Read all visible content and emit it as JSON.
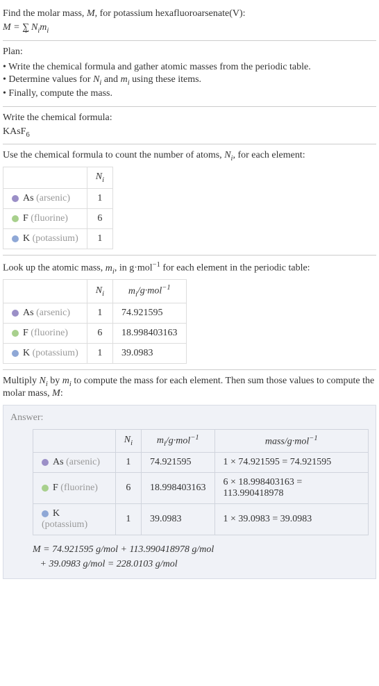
{
  "intro": {
    "line1_pre": "Find the molar mass, ",
    "line1_var": "M",
    "line1_post": ", for potassium hexafluoroarsenate(V):",
    "equation_html": "<i>M</i> = ∑<sub style='position:relative;left:-6px;'>i</sub><i>N<sub>i</sub>m<sub>i</sub></i>"
  },
  "plan": {
    "heading": "Plan:",
    "items": [
      "• Write the chemical formula and gather atomic masses from the periodic table.",
      "• Determine values for <i>N<sub>i</sub></i> and <i>m<sub>i</sub></i> using these items.",
      "• Finally, compute the mass."
    ]
  },
  "formula_section": {
    "heading": "Write the chemical formula:",
    "formula_html": "KAsF<sub>6</sub>"
  },
  "count_section": {
    "heading_html": "Use the chemical formula to count the number of atoms, <i>N<sub>i</sub></i>, for each element:",
    "header_ni_html": "<i>N<sub>i</sub></i>",
    "rows": [
      {
        "dot": "dot-purple",
        "sym": "As",
        "name": "(arsenic)",
        "ni": "1"
      },
      {
        "dot": "dot-green",
        "sym": "F",
        "name": "(fluorine)",
        "ni": "6"
      },
      {
        "dot": "dot-blue",
        "sym": "K",
        "name": "(potassium)",
        "ni": "1"
      }
    ]
  },
  "mass_section": {
    "heading_html": "Look up the atomic mass, <i>m<sub>i</sub></i>, in g·mol<sup>−1</sup> for each element in the periodic table:",
    "header_ni_html": "<i>N<sub>i</sub></i>",
    "header_mi_html": "<i>m<sub>i</sub></i>/g·mol<sup>−1</sup>",
    "rows": [
      {
        "dot": "dot-purple",
        "sym": "As",
        "name": "(arsenic)",
        "ni": "1",
        "mi": "74.921595"
      },
      {
        "dot": "dot-green",
        "sym": "F",
        "name": "(fluorine)",
        "ni": "6",
        "mi": "18.998403163"
      },
      {
        "dot": "dot-blue",
        "sym": "K",
        "name": "(potassium)",
        "ni": "1",
        "mi": "39.0983"
      }
    ]
  },
  "multiply_section": {
    "heading_html": "Multiply <i>N<sub>i</sub></i> by <i>m<sub>i</sub></i> to compute the mass for each element. Then sum those values to compute the molar mass, <i>M</i>:"
  },
  "answer": {
    "label": "Answer:",
    "header_ni_html": "<i>N<sub>i</sub></i>",
    "header_mi_html": "<i>m<sub>i</sub></i>/g·mol<sup>−1</sup>",
    "header_mass_html": "mass/g·mol<sup>−1</sup>",
    "rows": [
      {
        "dot": "dot-purple",
        "sym": "As",
        "name": "(arsenic)",
        "ni": "1",
        "mi": "74.921595",
        "mass": "1 × 74.921595 = 74.921595"
      },
      {
        "dot": "dot-green",
        "sym": "F",
        "name": "(fluorine)",
        "ni": "6",
        "mi": "18.998403163",
        "mass": "6 × 18.998403163 = 113.990418978"
      },
      {
        "dot": "dot-blue",
        "sym": "K",
        "name": "(potassium)",
        "ni": "1",
        "mi": "39.0983",
        "mass": "1 × 39.0983 = 39.0983"
      }
    ],
    "final_html": "<i>M</i> = 74.921595 g/mol + 113.990418978 g/mol<br>&nbsp;&nbsp;&nbsp;+ 39.0983 g/mol = 228.0103 g/mol"
  }
}
